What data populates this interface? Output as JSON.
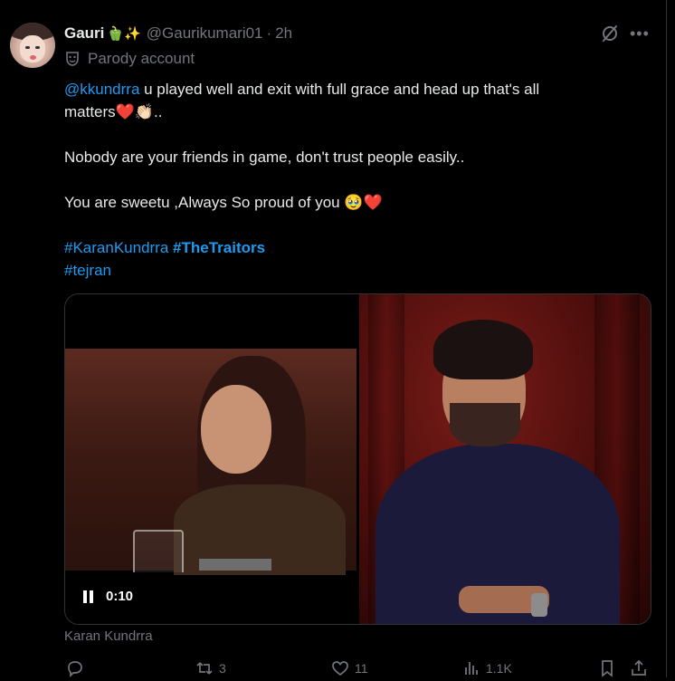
{
  "post": {
    "author": {
      "name": "Gauri",
      "emojis": "🫑✨",
      "handle": "@Gaurikumari01",
      "separator": "·",
      "time": "2h",
      "label": "Parody account"
    },
    "text": {
      "mention": "@kkundrra",
      "line1_rest": " u played well and exit with full grace and head up that's all",
      "line2": "matters❤️👏🏻..",
      "para2": "Nobody are your friends in game, don't trust people easily..",
      "para3": " You are sweetu ,Always So proud of you 🥹❤️",
      "hashtag1": "#KaranKundrra",
      "hashtag2": "#TheTraitors",
      "hashtag3": "#tejran"
    },
    "video": {
      "time": "0:10"
    },
    "caption": "Karan Kundrra",
    "actions": {
      "reply_count": "",
      "repost_count": "3",
      "like_count": "11",
      "views_count": "1.1K"
    }
  }
}
